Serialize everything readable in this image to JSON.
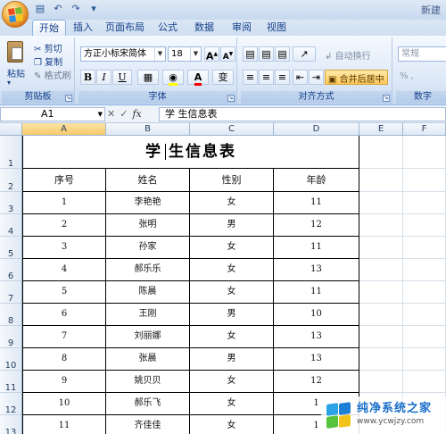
{
  "window": {
    "title_partial": "新建"
  },
  "tabs": [
    "开始",
    "插入",
    "页面布局",
    "公式",
    "数据",
    "审阅",
    "视图"
  ],
  "ribbon": {
    "clipboard": {
      "paste": "粘贴",
      "cut": "剪切",
      "copy": "复制",
      "format_painter": "格式刷",
      "label": "剪贴板"
    },
    "font": {
      "family": "方正小标宋简体",
      "size": "18",
      "grow": "A",
      "shrink": "A",
      "bold": "B",
      "italic": "I",
      "underline": "U",
      "font_color_glyph": "A",
      "change_case": "变",
      "label": "字体"
    },
    "alignment": {
      "wrap_text": "自动换行",
      "merge_center": "合并后居中",
      "label": "对齐方式"
    },
    "number": {
      "format": "常规",
      "label": "数字"
    }
  },
  "formula_bar": {
    "name_box": "A1",
    "fx": "fx",
    "content": "学  生信息表"
  },
  "sheet": {
    "columns": [
      "A",
      "B",
      "C",
      "D",
      "E",
      "F"
    ],
    "rows": [
      "1",
      "2",
      "3",
      "4",
      "5",
      "6",
      "7",
      "8",
      "9",
      "10",
      "11",
      "12",
      "13"
    ],
    "title_left": "学",
    "title_right": "生信息表",
    "headers": [
      "序号",
      "姓名",
      "性别",
      "年龄"
    ],
    "data": [
      [
        "1",
        "李艳艳",
        "女",
        "11"
      ],
      [
        "2",
        "张明",
        "男",
        "12"
      ],
      [
        "3",
        "孙家",
        "女",
        "11"
      ],
      [
        "4",
        "郝乐乐",
        "女",
        "13"
      ],
      [
        "5",
        "陈晨",
        "女",
        "11"
      ],
      [
        "6",
        "王刚",
        "男",
        "10"
      ],
      [
        "7",
        "刘丽娜",
        "女",
        "13"
      ],
      [
        "8",
        "张晨",
        "男",
        "13"
      ],
      [
        "9",
        "姚贝贝",
        "女",
        "12"
      ],
      [
        "10",
        "郝乐飞",
        "女",
        "1"
      ],
      [
        "11",
        "齐佳佳",
        "女",
        "1"
      ]
    ]
  },
  "watermark": {
    "name": "纯净系统之家",
    "url": "www.ycwjzy.com"
  }
}
